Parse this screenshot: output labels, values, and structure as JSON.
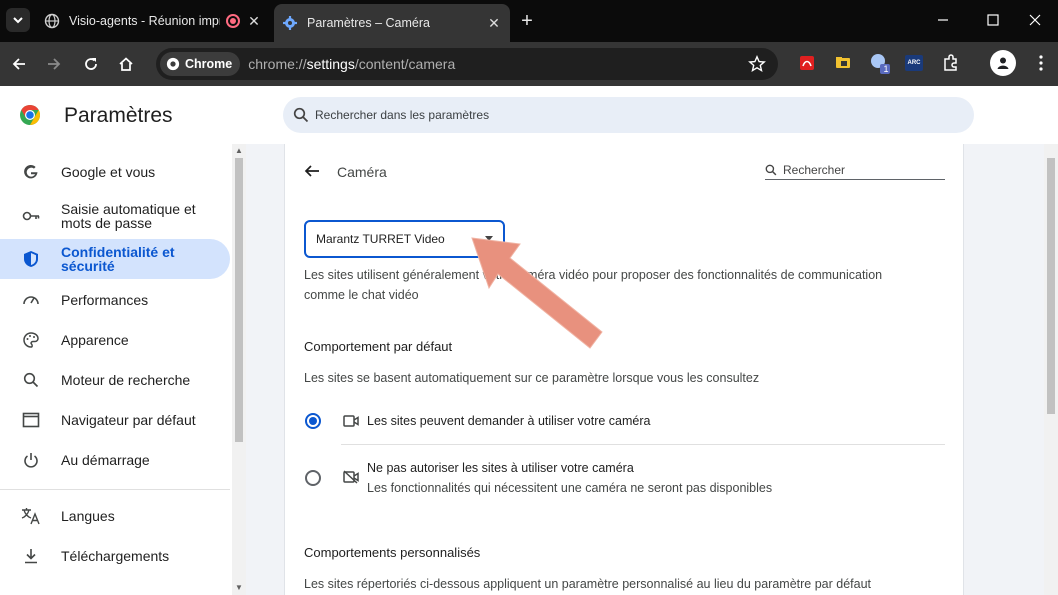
{
  "tabs": [
    {
      "title": "Visio-agents - Réunion impr",
      "active": false
    },
    {
      "title": "Paramètres – Caméra",
      "active": true
    }
  ],
  "toolbar": {
    "chip_label": "Chrome",
    "url_scheme": "chrome://",
    "url_host": "settings",
    "url_path": "/content/camera",
    "ext_badge": "1",
    "arc_label": "ARC"
  },
  "header": {
    "title": "Paramètres",
    "search_placeholder": "Rechercher dans les paramètres"
  },
  "sidebar": {
    "items": [
      {
        "label": "Google et vous",
        "icon": "google-icon"
      },
      {
        "label": "Saisie automatique et mots de passe",
        "icon": "key-icon"
      },
      {
        "label": "Confidentialité et sécurité",
        "icon": "shield-icon",
        "active": true
      },
      {
        "label": "Performances",
        "icon": "gauge-icon"
      },
      {
        "label": "Apparence",
        "icon": "palette-icon"
      },
      {
        "label": "Moteur de recherche",
        "icon": "search-icon"
      },
      {
        "label": "Navigateur par défaut",
        "icon": "browser-icon"
      },
      {
        "label": "Au démarrage",
        "icon": "power-icon"
      },
      {
        "label": "Langues",
        "icon": "translate-icon"
      },
      {
        "label": "Téléchargements",
        "icon": "download-icon"
      }
    ]
  },
  "main": {
    "heading": "Caméra",
    "search_placeholder": "Rechercher",
    "camera_select": "Marantz TURRET Video",
    "description_line1": "Les sites utilisent généralement votre caméra vidéo pour proposer des fonctionnalités de communication",
    "description_line2": "comme le chat vidéo",
    "default_heading": "Comportement par défaut",
    "default_sub": "Les sites se basent automatiquement sur ce paramètre lorsque vous les consultez",
    "options": [
      {
        "label": "Les sites peuvent demander à utiliser votre caméra",
        "checked": true,
        "icon": "camera-icon"
      },
      {
        "label": "Ne pas autoriser les sites à utiliser votre caméra",
        "sub": "Les fonctionnalités qui nécessitent une caméra ne seront pas disponibles",
        "checked": false,
        "icon": "camera-off-icon"
      }
    ],
    "custom_heading": "Comportements personnalisés",
    "custom_sub": "Les sites répertoriés ci-dessous appliquent un paramètre personnalisé au lieu du paramètre par défaut"
  },
  "colors": {
    "accent": "#0b57d0",
    "active_nav_bg": "#d3e3fd",
    "annotation_arrow": "#e8917e"
  }
}
